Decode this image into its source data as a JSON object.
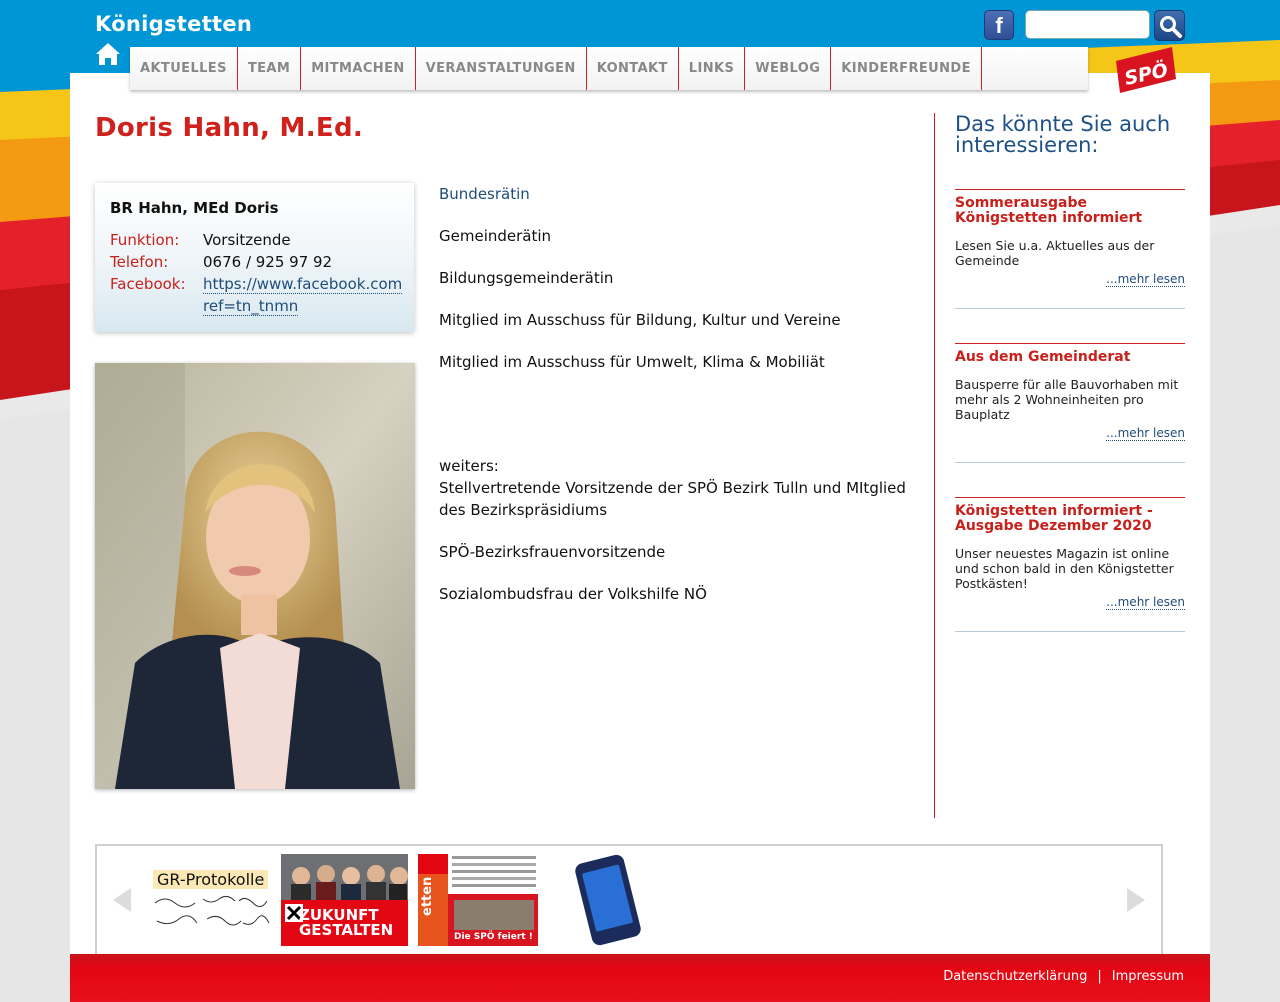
{
  "site": {
    "title": "Königstetten"
  },
  "colors": {
    "accent_red": "#d0211c",
    "link_blue": "#1f4d7a",
    "top_blue": "#0096d6"
  },
  "nav": {
    "items": [
      "AKTUELLES",
      "TEAM",
      "MITMACHEN",
      "VERANSTALTUNGEN",
      "KONTAKT",
      "LINKS",
      "WEBLOG",
      "KINDERFREUNDE"
    ]
  },
  "page": {
    "title": "Doris Hahn, M.Ed."
  },
  "card": {
    "name": "BR Hahn, MEd Doris",
    "function_label": "Funktion:",
    "function_value": "Vorsitzende",
    "phone_label": "Telefon:",
    "phone_value": "0676 / 925 97 92",
    "facebook_label": "Facebook:",
    "facebook_line1": "https://www.facebook.com",
    "facebook_line2": "ref=tn_tnmn"
  },
  "content": {
    "role1": "Bundesrätin",
    "role2": "Gemeinderätin",
    "role3": "Bildungsgemeinderätin",
    "role4": "Mitglied im Ausschuss für Bildung, Kultur und Vereine",
    "role5": "Mitglied im Ausschuss für Umwelt, Klima & Mobiliät",
    "further_label": "weiters:",
    "further1": "Stellvertretende Vorsitzende der SPÖ Bezirk Tulln und MItglied des Bezirkspräsidiums",
    "further2": "SPÖ-Bezirksfrauenvorsitzende",
    "further3": "Sozialombudsfrau der Volkshilfe NÖ"
  },
  "sidebar": {
    "heading": "Das könnte Sie auch interessieren:",
    "teasers": [
      {
        "title": "Sommerausgabe Königstetten informiert",
        "text": "Lesen Sie u.a. Aktuelles aus der Gemeinde",
        "more": "...mehr lesen"
      },
      {
        "title": "Aus dem Gemeinderat",
        "text": "Bausperre für alle Bauvorhaben mit mehr als 2 Wohneinheiten pro Bauplatz",
        "more": "...mehr lesen"
      },
      {
        "title": "Königstetten informiert - Ausgabe Dezember 2020",
        "text": "Unser neuestes Magazin ist online und schon bald in den Königstetter Postkästen!",
        "more": "...mehr lesen"
      }
    ]
  },
  "slider": {
    "gr_label": "GR-Protokolle",
    "zukunft_line1": "ZUKUNFT",
    "zukunft_line2": "GESTALTEN",
    "flyer_side": "etten",
    "flyer_bottom": "Die SPÖ feiert !"
  },
  "footer": {
    "privacy": "Datenschutzerklärung",
    "separator": "|",
    "imprint": "Impressum"
  }
}
